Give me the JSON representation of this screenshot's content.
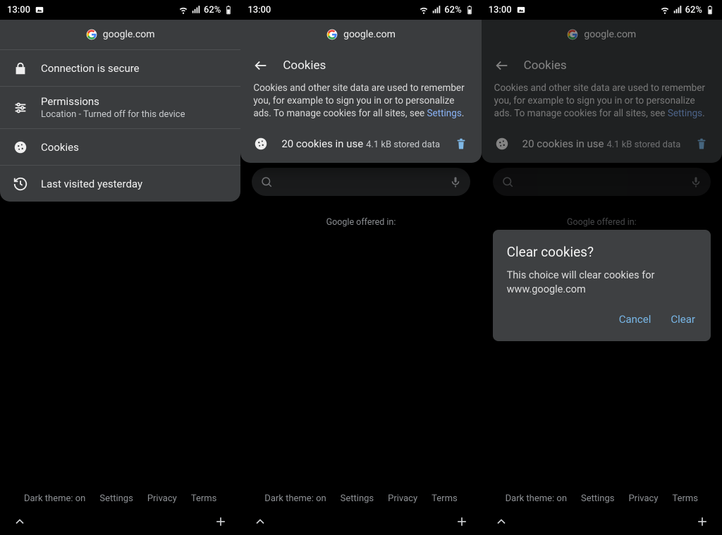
{
  "status": {
    "time": "13:00",
    "battery": "62%"
  },
  "domain": "google.com",
  "siteinfo": {
    "connection": "Connection is secure",
    "permissions_title": "Permissions",
    "permissions_sub": "Location - Turned off for this device",
    "cookies": "Cookies",
    "lastvisited": "Last visited yesterday"
  },
  "cookies_page": {
    "title": "Cookies",
    "desc_a": "Cookies and other site data are used to remember you, for example to sign you in or to personalize ads. To manage cookies for all sites, see ",
    "desc_link": "Settings",
    "desc_b": ".",
    "inuse": "20 cookies in use",
    "stored": "4.1 kB stored data"
  },
  "dialog": {
    "title": "Clear cookies?",
    "body": "This choice will clear cookies for www.google.com",
    "cancel": "Cancel",
    "clear": "Clear"
  },
  "under": {
    "offered": "Google offered in:",
    "offered_cursor": "Google offered in:   |",
    "dark": "Dark theme: on",
    "settings": "Settings",
    "privacy": "Privacy",
    "terms": "Terms"
  }
}
